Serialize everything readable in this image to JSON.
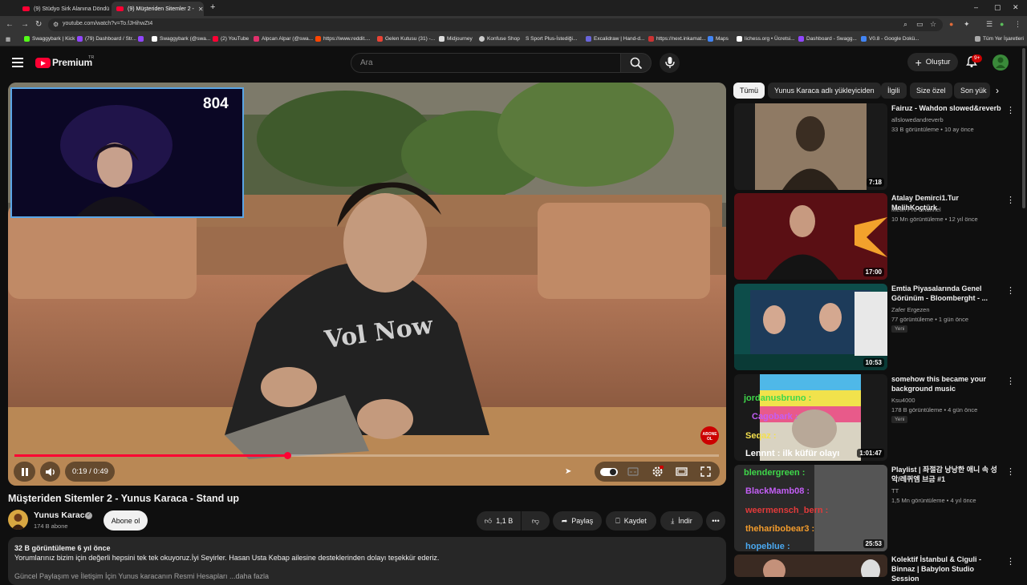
{
  "browser": {
    "tabs": [
      {
        "label": "(9) Stüdyo Sirk Alanına Döndü 🎤"
      },
      {
        "label": "(9) Müşteriden Sitemler 2 -"
      }
    ],
    "url": "youtube.com/watch?v=To.fJHihwZt4",
    "bookmarks": [
      "Swaggybark | Kick",
      "(79) Dashboard / Str...",
      "Swaggybark (@swa...",
      "(2) YouTube",
      "Alpcan Alpar (@swa...",
      "https://www.reddit....",
      "Gelen Kutusu (31) -...",
      "Midjourney",
      "Konfuse Shop",
      "S Sport Plus-İstediği...",
      "Excalidraw | Hand-d...",
      "https://next.inkamat...",
      "Maps",
      "lichess.org • Ücretsi...",
      "Dashboard - Swagg...",
      "V0.8 - Google Dokü...",
      "Tüm Yer İşaretleri"
    ]
  },
  "header": {
    "logo_text": "Premium",
    "logo_country": "TR",
    "search_placeholder": "Ara",
    "create_label": "Oluştur",
    "notifications_badge": "9+"
  },
  "player": {
    "overlay_count": "804",
    "time": "0:19 / 0:49",
    "progress": 0.388,
    "abone_badge": "ABONE OL"
  },
  "video": {
    "title": "Müşteriden Sitemler 2 - Yunus Karaca - Stand up",
    "channel": "Yunus Karaca",
    "subscribers": "174 B abone",
    "subscribe_label": "Abone ol",
    "like_count": "1,1 B",
    "share_label": "Paylaş",
    "save_label": "Kaydet",
    "download_label": "İndir",
    "views_line": "32 B görüntüleme  6 yıl önce",
    "description": "Yorumlarınız bizim için değerli hepsini tek tek okuyoruz.İyi Seyirler. Hasan Usta Kebap ailesine desteklerinden dolayı teşekkür ederiz.",
    "description_more": "Güncel Paylaşım ve İletişim İçin Yunus karacanın Resmi Hesapları ...daha fazla"
  },
  "chips": [
    "Tümü",
    "Yunus Karaca adlı yükleyiciden",
    "İlgili",
    "Size özel",
    "Son yük"
  ],
  "recommendations": [
    {
      "title": "Fairuz - Wahdon slowed&reverb",
      "channel": "allslowedandreverb",
      "stats": "33 B görüntüleme • 10 ay önce",
      "duration": "7:18",
      "badge": ""
    },
    {
      "title": "Atalay Demirci1.Tur  MelihKoçtürk",
      "channel": "Melih Pro Channel",
      "stats": "10 Mn görüntüleme • 12 yıl önce",
      "duration": "17:00",
      "badge": ""
    },
    {
      "title": "Emtia Piyasalarında Genel Görünüm - Bloomberght - ...",
      "channel": "Zafer Ergezen",
      "stats": "77 görüntüleme • 1 gün önce",
      "duration": "10:53",
      "badge": "Yeni"
    },
    {
      "title": "somehow this became your background music",
      "channel": "Ksu4000",
      "stats": "178 B görüntüleme • 4 gün önce",
      "duration": "1:01:47",
      "badge": "Yeni"
    },
    {
      "title": "Playlist | 좌절감 낭낭한 애니 속 성악/레퀴엠 브금 #1",
      "channel": "TT",
      "stats": "1,5 Mn görüntüleme • 4 yıl önce",
      "duration": "25:53",
      "badge": ""
    },
    {
      "title": "Kolektif İstanbul & Ciguli - Binnaz | Babylon Studio Session",
      "channel": "",
      "stats": "",
      "duration": "",
      "badge": ""
    }
  ],
  "thumb_texts": {
    "chat1": "jordanusbruno :",
    "chat2": "Cagobark :",
    "chat3": "Seqaz :",
    "chat4": "Lennnt : ilk küfür olayı",
    "chat5": "blendergreen :",
    "chat6": "BlackMamb08 :",
    "chat7": "weermensch_bern :",
    "chat8": "theharibobear3 :",
    "chat9": "hopeblue :"
  },
  "colors": {
    "background": "#0f0f0f",
    "accent_red": "#ff0033",
    "chip_bg": "#272727"
  }
}
